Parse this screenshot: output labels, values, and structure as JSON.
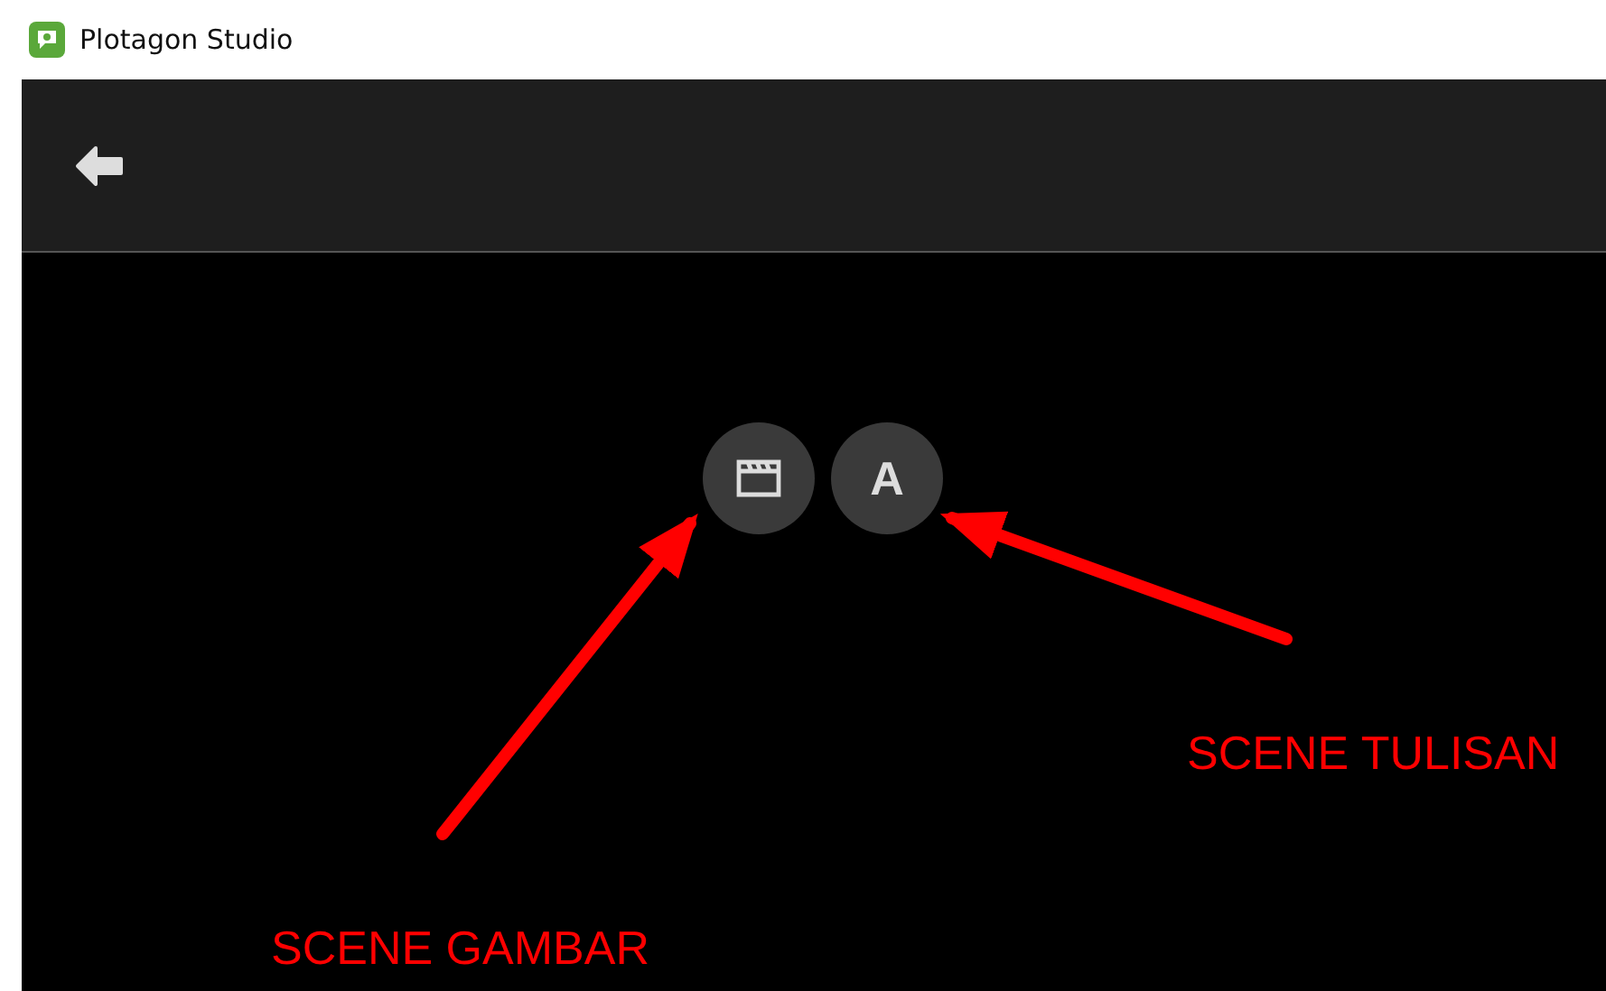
{
  "window": {
    "title": "Plotagon Studio"
  },
  "scene_buttons": [
    {
      "kind": "clapper"
    },
    {
      "kind": "letter",
      "label": "A"
    }
  ],
  "annotations": [
    {
      "text": "SCENE TULISAN"
    },
    {
      "text": "SCENE GAMBAR"
    }
  ]
}
